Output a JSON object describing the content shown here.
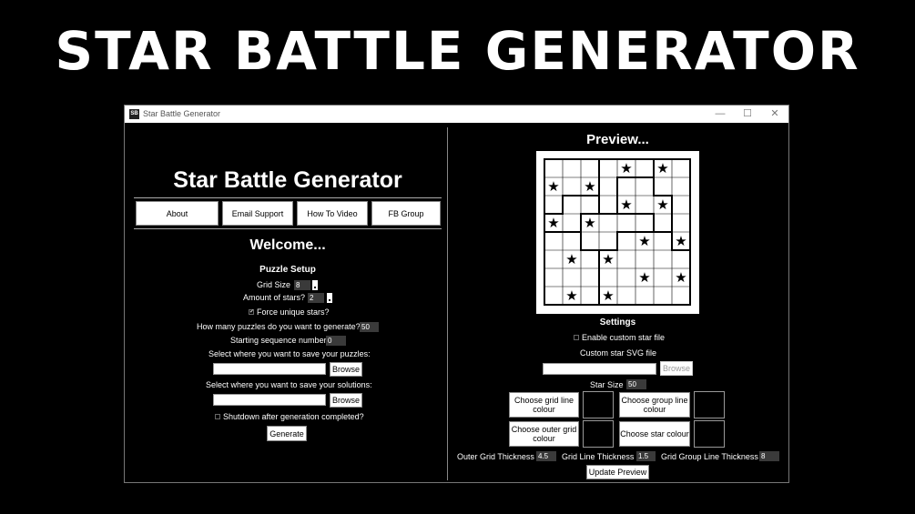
{
  "banner": "STAR BATTLE GENERATOR",
  "window": {
    "title": "Star Battle Generator",
    "icon": "SB",
    "minimize": "—",
    "maximize": "☐",
    "close": "✕"
  },
  "left": {
    "heading": "Star Battle Generator",
    "nav": [
      "About",
      "Email Support",
      "How To Video",
      "FB Group"
    ],
    "welcome": "Welcome...",
    "puzzle_setup": "Puzzle Setup",
    "grid_size_label": "Grid Size",
    "grid_size_value": "8",
    "stars_label": "Amount of stars?",
    "stars_value": "2",
    "force_unique_label": "Force unique stars?",
    "force_unique_checked": true,
    "count_label": "How many puzzles do you want to generate?",
    "count_value": "50",
    "seq_label": "Starting sequence number",
    "seq_value": "0",
    "save_puzzles_label": "Select where you want to save your puzzles:",
    "save_solutions_label": "Select where you want to save your solutions:",
    "browse": "Browse",
    "shutdown_label": "Shutdown after generation completed?",
    "shutdown_checked": false,
    "generate": "Generate"
  },
  "right": {
    "preview_title": "Preview...",
    "settings": "Settings",
    "custom_star_label": "Enable custom star file",
    "custom_star_checked": false,
    "svg_label": "Custom star SVG file",
    "browse": "Browse",
    "star_size_label": "Star Size",
    "star_size_value": "50",
    "grid_line_colour": "Choose grid line colour",
    "group_line_colour": "Choose group line colour",
    "outer_grid_colour": "Choose outer grid colour",
    "star_colour": "Choose star colour",
    "outer_thickness_label": "Outer Grid Thickness",
    "outer_thickness_value": "4.5",
    "grid_line_thickness_label": "Grid Line Thickness",
    "grid_line_thickness_value": "1.5",
    "group_thickness_label": "Grid Group Line Thickness",
    "group_thickness_value": "8",
    "update": "Update Preview"
  },
  "puzzle": {
    "size": 8,
    "star_glyph": "★",
    "stars": [
      [
        0,
        4
      ],
      [
        0,
        6
      ],
      [
        1,
        0
      ],
      [
        1,
        2
      ],
      [
        2,
        4
      ],
      [
        2,
        6
      ],
      [
        3,
        0
      ],
      [
        3,
        2
      ],
      [
        4,
        5
      ],
      [
        4,
        7
      ],
      [
        5,
        1
      ],
      [
        5,
        3
      ],
      [
        6,
        5
      ],
      [
        6,
        7
      ],
      [
        7,
        1
      ],
      [
        7,
        3
      ]
    ],
    "regions": [
      [
        0,
        0,
        0,
        1,
        1,
        1,
        2,
        2
      ],
      [
        0,
        0,
        0,
        1,
        3,
        3,
        2,
        2
      ],
      [
        0,
        4,
        4,
        1,
        3,
        3,
        3,
        2
      ],
      [
        4,
        4,
        5,
        5,
        5,
        5,
        3,
        2
      ],
      [
        6,
        6,
        5,
        5,
        7,
        7,
        7,
        2
      ],
      [
        6,
        6,
        6,
        7,
        7,
        7,
        7,
        7
      ],
      [
        6,
        6,
        6,
        7,
        7,
        7,
        7,
        7
      ],
      [
        6,
        6,
        6,
        7,
        7,
        7,
        7,
        7
      ]
    ]
  }
}
